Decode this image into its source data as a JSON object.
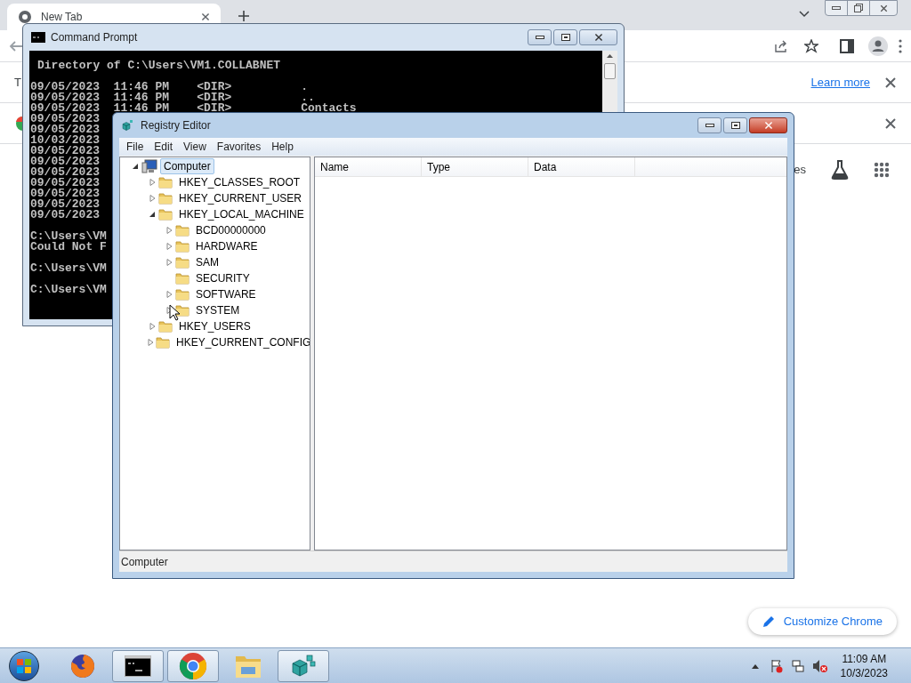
{
  "browser": {
    "tab": {
      "title": "New Tab"
    },
    "infobar": {
      "text": "T",
      "link": "Learn more"
    },
    "shortcut_text": "es",
    "customize_button": "Customize Chrome"
  },
  "cmd": {
    "title": "Command Prompt",
    "blocks": [
      [
        "Directory of C:\\Users\\VM1.COLLABNET"
      ],
      [
        "09/05/2023  11:46 PM    <DIR>          .",
        "09/05/2023  11:46 PM    <DIR>          ..",
        "09/05/2023  11:46 PM    <DIR>          Contacts",
        "09/05/2023",
        "09/05/2023",
        "10/03/2023",
        "09/05/2023",
        "09/05/2023",
        "09/05/2023",
        "09/05/2023",
        "09/05/2023",
        "09/05/2023",
        "09/05/2023"
      ],
      [
        "C:\\Users\\VM",
        "Could Not F"
      ],
      [
        "C:\\Users\\VM"
      ],
      [
        "C:\\Users\\VM"
      ]
    ]
  },
  "regedit": {
    "title": "Registry Editor",
    "menu": [
      "File",
      "Edit",
      "View",
      "Favorites",
      "Help"
    ],
    "tree": [
      {
        "label": "Computer",
        "selected": true,
        "expandable": true,
        "expanded": true,
        "children": [
          {
            "label": "HKEY_CLASSES_ROOT",
            "selected": false,
            "expandable": true
          },
          {
            "label": "HKEY_CURRENT_USER",
            "selected": false,
            "expandable": true
          },
          {
            "label": "HKEY_LOCAL_MACHINE",
            "selected": false,
            "expandable": true,
            "expanded": true,
            "children": [
              {
                "label": "BCD00000000",
                "selected": false,
                "expandable": true
              },
              {
                "label": "HARDWARE",
                "selected": false,
                "expandable": true
              },
              {
                "label": "SAM",
                "selected": false,
                "expandable": true
              },
              {
                "label": "SECURITY",
                "selected": false,
                "expandable": false
              },
              {
                "label": "SOFTWARE",
                "selected": false,
                "expandable": true
              },
              {
                "label": "SYSTEM",
                "selected": false,
                "expandable": true
              }
            ]
          },
          {
            "label": "HKEY_USERS",
            "selected": false,
            "expandable": true
          },
          {
            "label": "HKEY_CURRENT_CONFIG",
            "selected": false,
            "expandable": true
          }
        ]
      }
    ],
    "columns": [
      "Name",
      "Type",
      "Data"
    ],
    "status": "Computer"
  },
  "taskbar": {
    "items": [
      {
        "kind": "firefox",
        "active": false
      },
      {
        "kind": "console",
        "active": true
      },
      {
        "kind": "chrome",
        "active": true
      },
      {
        "kind": "folder",
        "active": false
      },
      {
        "kind": "registry",
        "active": true
      }
    ],
    "clock": {
      "time": "11:09 AM",
      "date": "10/3/2023"
    }
  }
}
